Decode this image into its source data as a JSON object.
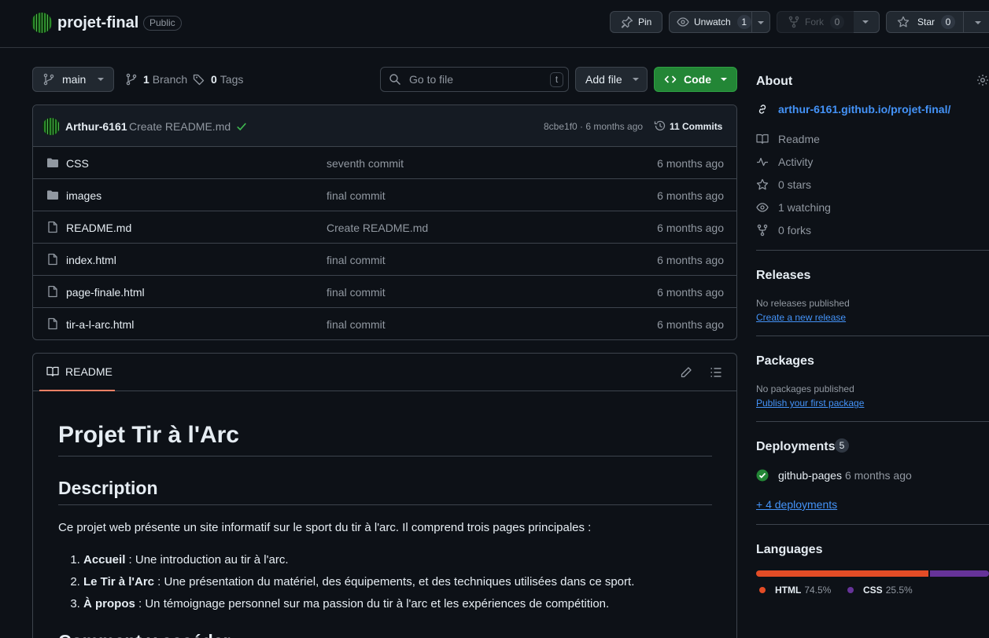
{
  "repo": {
    "name": "projet-final",
    "visibility": "Public"
  },
  "actions": {
    "pin": "Pin",
    "unwatch": "Unwatch",
    "watch_count": "1",
    "fork": "Fork",
    "fork_count": "0",
    "star": "Star",
    "star_count": "0"
  },
  "toolbar": {
    "branch": "main",
    "branch_count": "1",
    "branch_label": "Branch",
    "tag_count": "0",
    "tag_label": "Tags",
    "search_placeholder": "Go to file",
    "search_shortcut": "t",
    "add_file": "Add file",
    "code": "Code"
  },
  "commit": {
    "author": "Arthur-6161",
    "message": "Create README.md",
    "hash_time": "8cbe1f0 · 6 months ago",
    "commits": "11 Commits"
  },
  "files": [
    {
      "type": "folder",
      "name": "CSS",
      "message": "seventh commit",
      "date": "6 months ago"
    },
    {
      "type": "folder",
      "name": "images",
      "message": "final commit",
      "date": "6 months ago"
    },
    {
      "type": "file",
      "name": "README.md",
      "message": "Create README.md",
      "date": "6 months ago"
    },
    {
      "type": "file",
      "name": "index.html",
      "message": "final commit",
      "date": "6 months ago"
    },
    {
      "type": "file",
      "name": "page-finale.html",
      "message": "final commit",
      "date": "6 months ago"
    },
    {
      "type": "file",
      "name": "tir-a-l-arc.html",
      "message": "final commit",
      "date": "6 months ago"
    }
  ],
  "readme": {
    "tab": "README",
    "h1": "Projet Tir à l'Arc",
    "h2": "Description",
    "intro": "Ce projet web présente un site informatif sur le sport du tir à l'arc. Il comprend trois pages principales :",
    "items": [
      {
        "bold": "Accueil",
        "text": " : Une introduction au tir à l'arc."
      },
      {
        "bold": "Le Tir à l'Arc",
        "text": " : Une présentation du matériel, des équipements, et des techniques utilisées dans ce sport."
      },
      {
        "bold": "À propos",
        "text": " : Un témoignage personnel sur ma passion du tir à l'arc et les expériences de compétition."
      }
    ],
    "next_heading": "Comment y accéder"
  },
  "about": {
    "title": "About",
    "website": "arthur-6161.github.io/projet-final/",
    "readme": "Readme",
    "activity": "Activity",
    "stars": "0 stars",
    "watching": "1 watching",
    "forks": "0 forks"
  },
  "releases": {
    "title": "Releases",
    "none": "No releases published",
    "create": "Create a new release"
  },
  "packages": {
    "title": "Packages",
    "none": "No packages published",
    "publish": "Publish your first package"
  },
  "deployments": {
    "title": "Deployments",
    "count": "5",
    "env": "github-pages",
    "time": "6 months ago",
    "more": "+ 4 deployments"
  },
  "languages": {
    "title": "Languages",
    "items": [
      {
        "name": "HTML",
        "percent": "74.5%",
        "value": 74.5,
        "color": "#e34c26"
      },
      {
        "name": "CSS",
        "percent": "25.5%",
        "value": 25.5,
        "color": "#663399"
      }
    ]
  }
}
